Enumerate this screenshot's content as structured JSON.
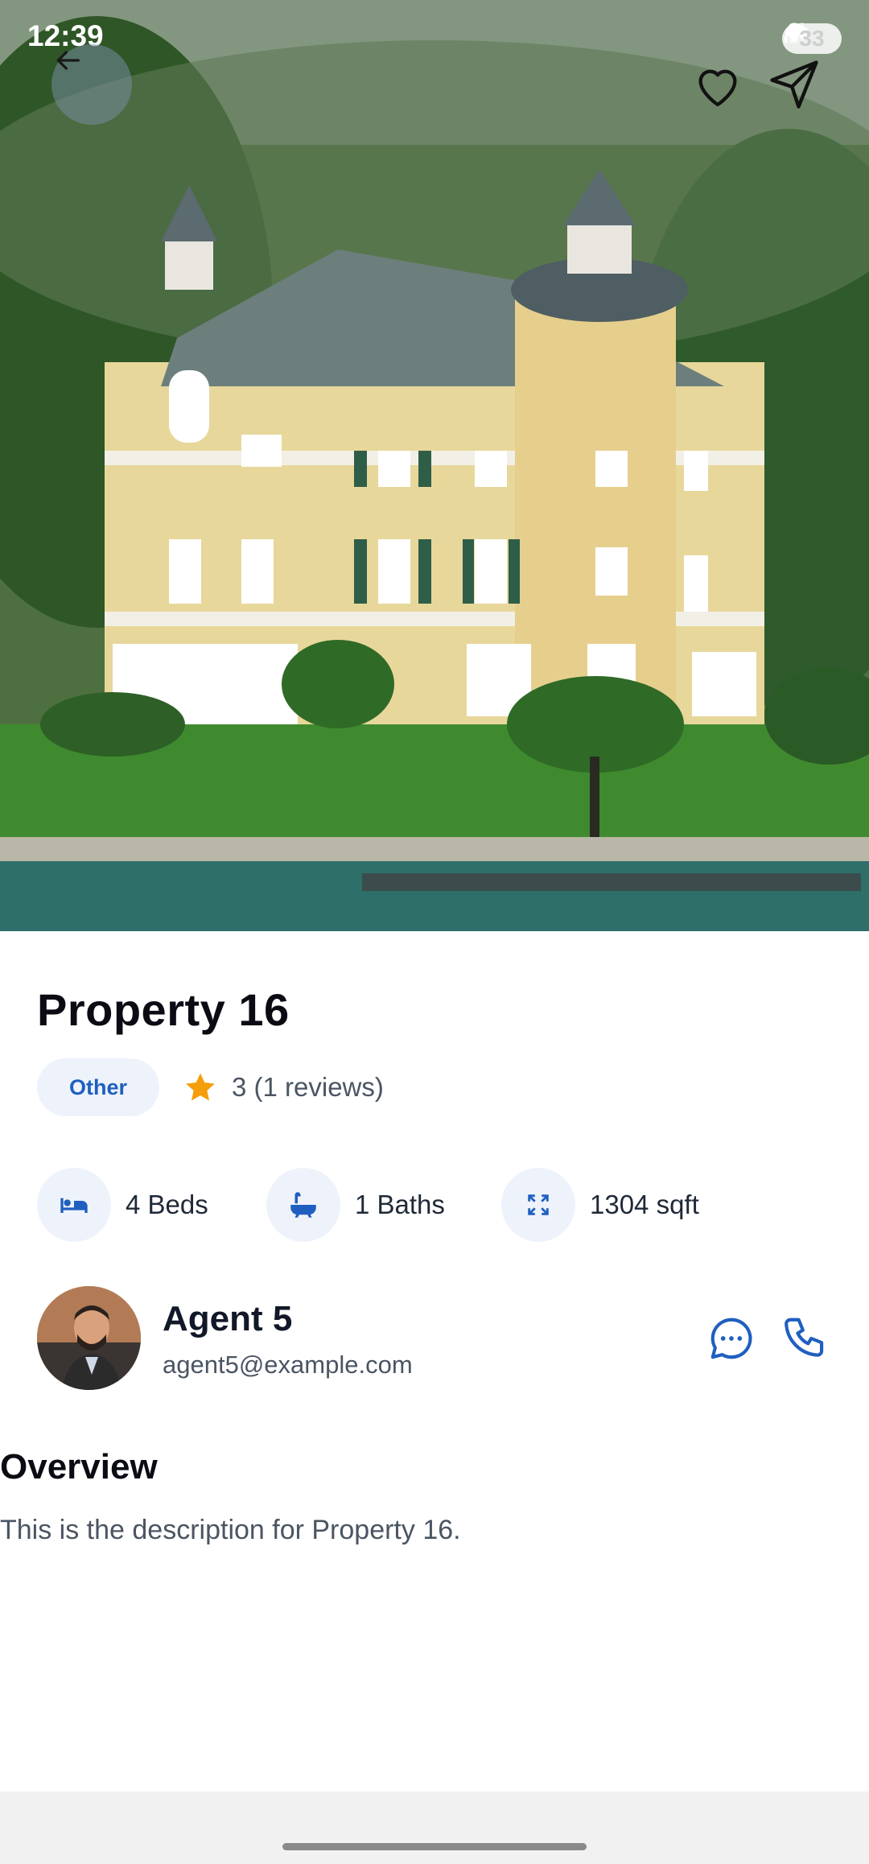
{
  "status_bar": {
    "time": "12:39",
    "battery": "33",
    "icons": [
      "mute-icon",
      "location-icon",
      "wifi-icon",
      "signal-icon",
      "battery-icon"
    ]
  },
  "header": {
    "icons": [
      "back-arrow-icon",
      "heart-icon",
      "share-send-icon"
    ]
  },
  "property": {
    "title": "Property 16",
    "tag": "Other",
    "rating_text": "3 (1 reviews)",
    "features": [
      {
        "icon": "bed-icon",
        "label": "4 Beds"
      },
      {
        "icon": "bathtub-icon",
        "label": "1 Baths"
      },
      {
        "icon": "expand-icon",
        "label": "1304 sqft"
      }
    ]
  },
  "agent": {
    "name": "Agent 5",
    "email": "agent5@example.com",
    "actions": [
      "chat-icon",
      "phone-icon"
    ]
  },
  "overview": {
    "heading": "Overview",
    "description": "This is the description for Property 16."
  },
  "colors": {
    "accent": "#1f5fbf",
    "chip_bg": "#eef3fb",
    "star": "#f59e0b"
  }
}
